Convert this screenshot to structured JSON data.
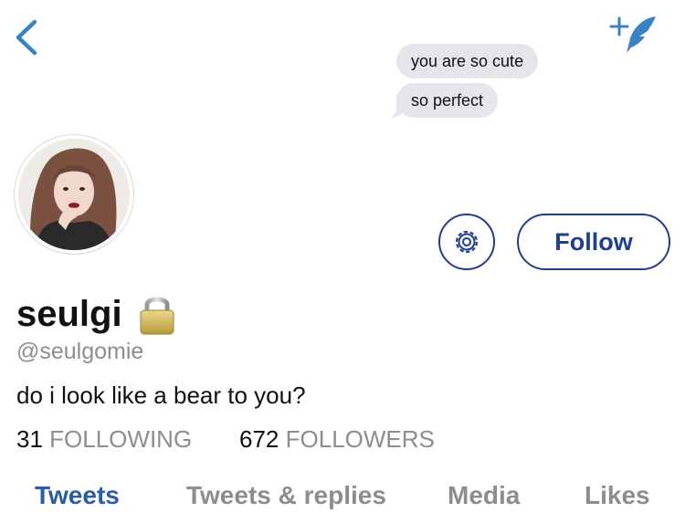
{
  "message_bubbles": [
    "you are so cute",
    "so perfect"
  ],
  "profile": {
    "display_name": "seulgi",
    "handle": "@seulgomie",
    "bio": "do i look like a bear to you?",
    "following_count": "31",
    "following_label": "FOLLOWING",
    "followers_count": "672",
    "followers_label": "FOLLOWERS",
    "locked": true
  },
  "actions": {
    "follow_label": "Follow",
    "settings_icon": "gear-icon",
    "back_icon": "chevron-left-icon",
    "compose_icon": "compose-tweet-icon"
  },
  "tabs": [
    {
      "label": "Tweets",
      "active": true
    },
    {
      "label": "Tweets & replies",
      "active": false
    },
    {
      "label": "Media",
      "active": false
    },
    {
      "label": "Likes",
      "active": false
    }
  ],
  "colors": {
    "accent": "#2a5da8",
    "button_border": "#1f3f8a",
    "muted_text": "#8a8d91",
    "bubble_bg": "#e5e5ea"
  }
}
